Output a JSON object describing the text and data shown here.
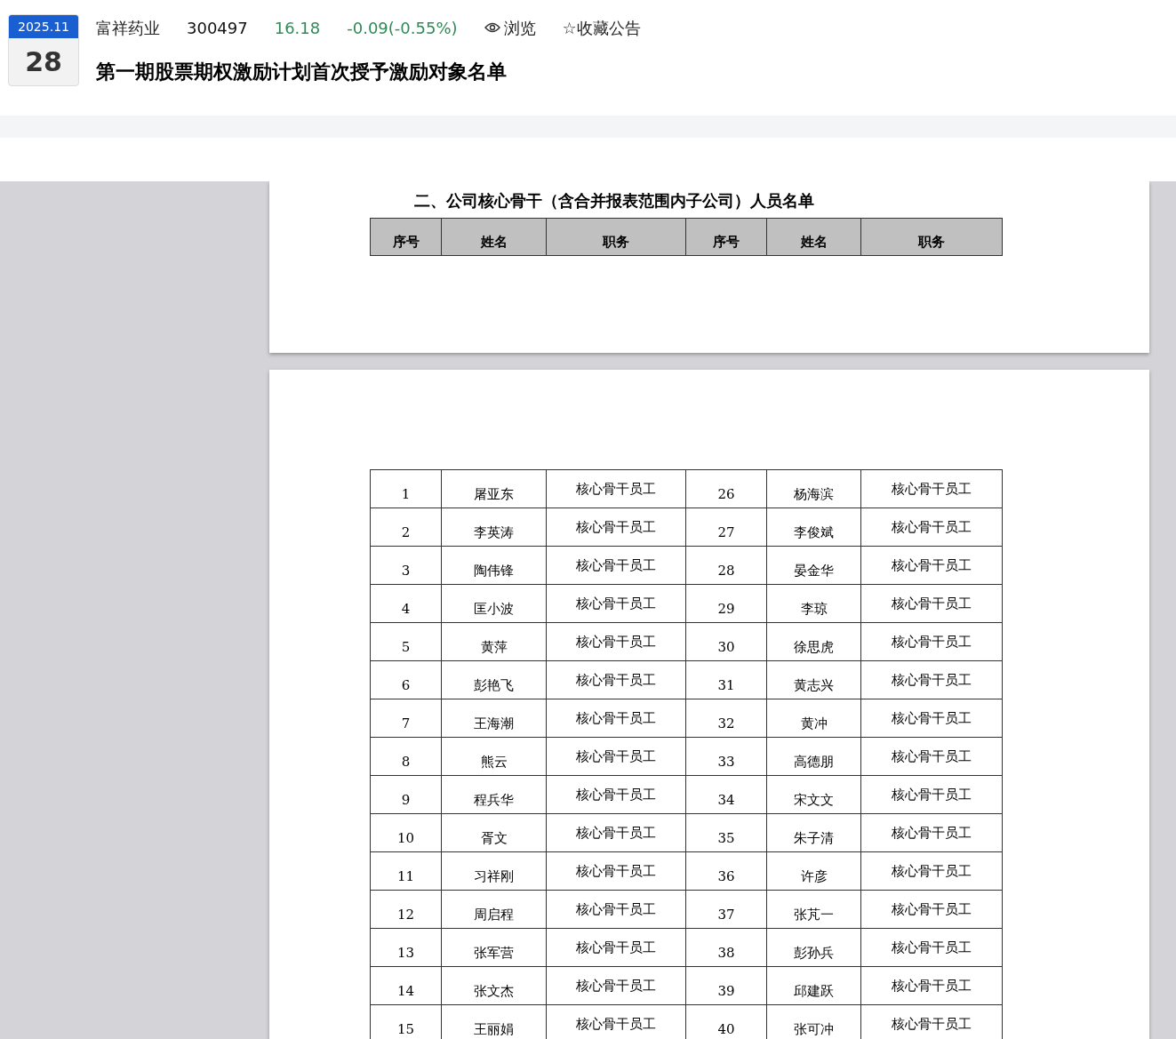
{
  "header": {
    "date_month": "2025.11",
    "date_day": "28",
    "company": "富祥药业",
    "code": "300497",
    "price": "16.18",
    "change": "-0.09(-0.55%)",
    "browse": "浏览",
    "favorite": "☆收藏公告",
    "title": "第一期股票期权激励计划首次授予激励对象名单"
  },
  "document": {
    "section_title": "二、公司核心骨干（含合并报表范围内子公司）人员名单",
    "columns": [
      "序号",
      "姓名",
      "职务",
      "序号",
      "姓名",
      "职务"
    ],
    "rows": [
      [
        "1",
        "屠亚东",
        "核心骨干员工",
        "26",
        "杨海滨",
        "核心骨干员工"
      ],
      [
        "2",
        "李英涛",
        "核心骨干员工",
        "27",
        "李俊斌",
        "核心骨干员工"
      ],
      [
        "3",
        "陶伟锋",
        "核心骨干员工",
        "28",
        "晏金华",
        "核心骨干员工"
      ],
      [
        "4",
        "匡小波",
        "核心骨干员工",
        "29",
        "李琼",
        "核心骨干员工"
      ],
      [
        "5",
        "黄萍",
        "核心骨干员工",
        "30",
        "徐思虎",
        "核心骨干员工"
      ],
      [
        "6",
        "彭艳飞",
        "核心骨干员工",
        "31",
        "黄志兴",
        "核心骨干员工"
      ],
      [
        "7",
        "王海潮",
        "核心骨干员工",
        "32",
        "黄冲",
        "核心骨干员工"
      ],
      [
        "8",
        "熊云",
        "核心骨干员工",
        "33",
        "高德朋",
        "核心骨干员工"
      ],
      [
        "9",
        "程兵华",
        "核心骨干员工",
        "34",
        "宋文文",
        "核心骨干员工"
      ],
      [
        "10",
        "胥文",
        "核心骨干员工",
        "35",
        "朱子清",
        "核心骨干员工"
      ],
      [
        "11",
        "习祥刚",
        "核心骨干员工",
        "36",
        "许彦",
        "核心骨干员工"
      ],
      [
        "12",
        "周启程",
        "核心骨干员工",
        "37",
        "张芃一",
        "核心骨干员工"
      ],
      [
        "13",
        "张军营",
        "核心骨干员工",
        "38",
        "彭孙兵",
        "核心骨干员工"
      ],
      [
        "14",
        "张文杰",
        "核心骨干员工",
        "39",
        "邱建跃",
        "核心骨干员工"
      ],
      [
        "15",
        "王丽娟",
        "核心骨干员工",
        "40",
        "张可冲",
        "核心骨干员工"
      ]
    ]
  }
}
